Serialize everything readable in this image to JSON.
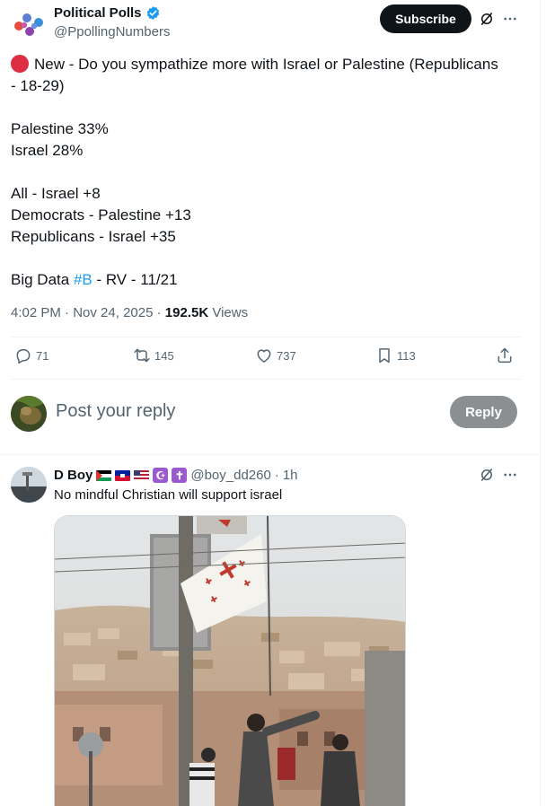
{
  "post": {
    "author_name": "Political Polls",
    "author_handle": "@PpollingNumbers",
    "subscribe_label": "Subscribe",
    "lines": [
      "New - Do you sympathize more with Israel or Palestine (Republicans",
      "- 18-29)",
      "",
      "Palestine 33%",
      "Israel 28%",
      "",
      "All - Israel +8",
      "Democrats - Palestine +13",
      "Republicans - Israel +35",
      ""
    ],
    "source_prefix": "Big Data ",
    "hashtag": "#B",
    "source_suffix": " - RV - 11/21",
    "time": "4:02 PM",
    "date": "Nov 24, 2025",
    "views_count": "192.5K",
    "views_label": "Views"
  },
  "actions": {
    "replies": "71",
    "reposts": "145",
    "likes": "737",
    "bookmarks": "113"
  },
  "reply_box": {
    "placeholder": "Post your reply",
    "button_label": "Reply"
  },
  "reply": {
    "name": "D Boy",
    "handle": "@boy_dd260",
    "time": "1h",
    "text": "No mindful Christian will support israel",
    "symbols": [
      "☪",
      "✝"
    ]
  },
  "colors": {
    "accent": "#1d9bf0",
    "dark_button": "#0f1419",
    "red_dot": "#dd2e44",
    "reply_button": "#8b8f92"
  },
  "icons": [
    "verified-badge-icon",
    "grok-icon",
    "more-icon",
    "reply-icon",
    "repost-icon",
    "like-icon",
    "bookmark-icon",
    "share-icon"
  ]
}
